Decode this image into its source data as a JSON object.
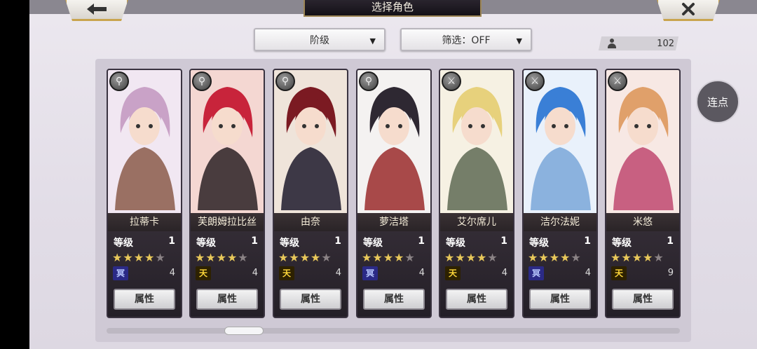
{
  "header": {
    "title": "选择角色",
    "back_icon": "arrow-left-icon",
    "close_icon": "close-icon"
  },
  "filters": {
    "sort_label": "阶级",
    "filter_label": "筛选：OFF"
  },
  "count": {
    "value": "102"
  },
  "side_button": {
    "label": "连点"
  },
  "level_label": "等级",
  "attr_label": "属性",
  "colors": {
    "gold": "#c9a44e",
    "star": "#e8c85a",
    "badge_blue": "#2b2a86",
    "badge_gold": "#ffd83a"
  },
  "characters": [
    {
      "name": "拉蒂卡",
      "level": "1",
      "stars_filled": 4,
      "stars_total": 5,
      "type_glyph": "冥",
      "type_color": "blue",
      "sub": "4",
      "weapon": "staff-icon",
      "palette": [
        "#f1e7f2",
        "#c9a2c7",
        "#8b5a4a"
      ]
    },
    {
      "name": "芙朗姆拉比丝",
      "level": "1",
      "stars_filled": 4,
      "stars_total": 5,
      "type_glyph": "天",
      "type_color": "gold",
      "sub": "4",
      "weapon": "staff-icon",
      "palette": [
        "#f4d7d2",
        "#c8243b",
        "#2a2124"
      ]
    },
    {
      "name": "由奈",
      "level": "1",
      "stars_filled": 4,
      "stars_total": 5,
      "type_glyph": "天",
      "type_color": "gold",
      "sub": "4",
      "weapon": "staff-icon",
      "palette": [
        "#efe4da",
        "#7b1a22",
        "#1d1a2c"
      ]
    },
    {
      "name": "萝洁塔",
      "level": "1",
      "stars_filled": 4,
      "stars_total": 5,
      "type_glyph": "冥",
      "type_color": "blue",
      "sub": "4",
      "weapon": "staff-icon",
      "palette": [
        "#f4f2f1",
        "#2e2832",
        "#9a2b2b"
      ]
    },
    {
      "name": "艾尔席儿",
      "level": "1",
      "stars_filled": 4,
      "stars_total": 5,
      "type_glyph": "天",
      "type_color": "gold",
      "sub": "4",
      "weapon": "sword-icon",
      "palette": [
        "#f6f1e3",
        "#e7d17c",
        "#5e6a54"
      ]
    },
    {
      "name": "洁尔法妮",
      "level": "1",
      "stars_filled": 4,
      "stars_total": 5,
      "type_glyph": "冥",
      "type_color": "blue",
      "sub": "4",
      "weapon": "sword-icon",
      "palette": [
        "#e9f1fb",
        "#3a7fd6",
        "#7aa7d8"
      ]
    },
    {
      "name": "米悠",
      "level": "1",
      "stars_filled": 4,
      "stars_total": 5,
      "type_glyph": "天",
      "type_color": "gold",
      "sub": "9",
      "weapon": "sword-icon",
      "palette": [
        "#f7e8e4",
        "#e0a06a",
        "#c04870"
      ]
    }
  ]
}
